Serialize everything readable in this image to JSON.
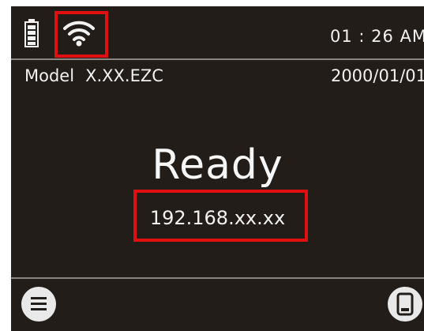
{
  "status_bar": {
    "battery_icon": "battery-full-icon",
    "wifi_icon": "wifi-icon",
    "time": "01 : 26 AM"
  },
  "info_bar": {
    "model_label": "Model",
    "model_version": "X.XX.EZC",
    "date": "2000/01/01"
  },
  "main": {
    "status": "Ready",
    "ip_address": "192.168.xx.xx"
  },
  "footer": {
    "menu_icon": "menu-icon",
    "device_icon": "device-icon"
  },
  "colors": {
    "screen_bg": "#221d18",
    "text": "#f2f2f2",
    "highlight": "#e01010"
  }
}
